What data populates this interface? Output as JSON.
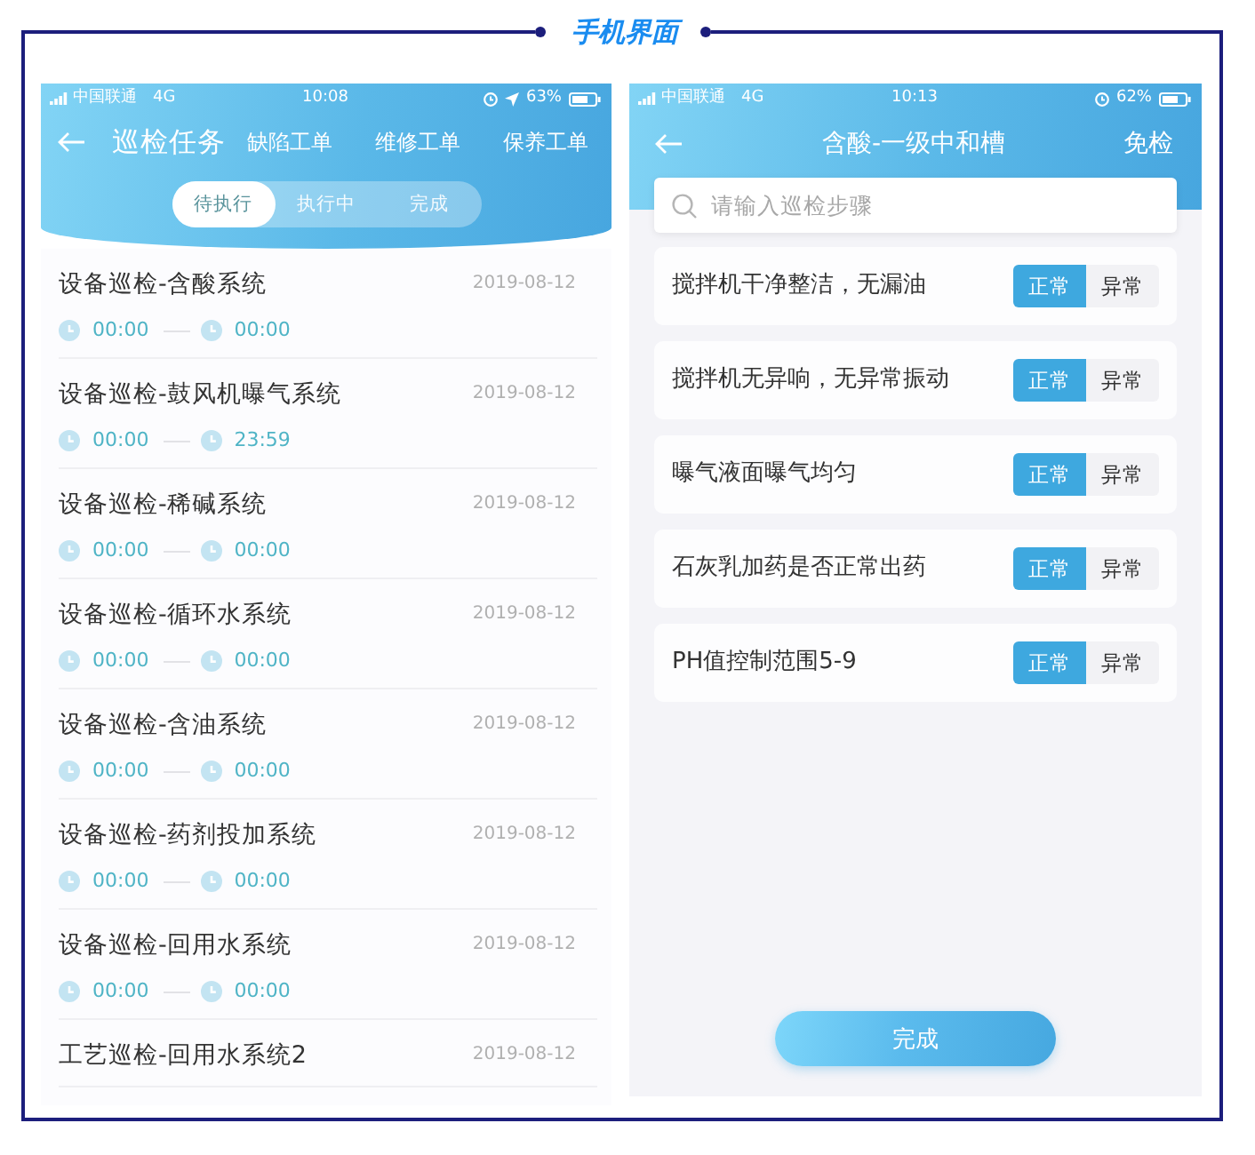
{
  "caption": "手机界面",
  "task_list_screen": {
    "status_bar": {
      "carrier": "中国联通",
      "network": "4G",
      "time": "10:08",
      "location": true,
      "battery": "63%"
    },
    "header": {
      "title": "巡检任务",
      "links": [
        "缺陷工单",
        "维修工单",
        "保养工单"
      ]
    },
    "tabs": [
      {
        "label": "待执行",
        "selected": true
      },
      {
        "label": "执行中",
        "selected": false
      },
      {
        "label": "完成",
        "selected": false
      }
    ],
    "tasks": [
      {
        "title": "设备巡检-含酸系统",
        "date": "2019-08-12",
        "start": "00:00",
        "end": "00:00"
      },
      {
        "title": "设备巡检-鼓风机曝气系统",
        "date": "2019-08-12",
        "start": "00:00",
        "end": "23:59"
      },
      {
        "title": "设备巡检-稀碱系统",
        "date": "2019-08-12",
        "start": "00:00",
        "end": "00:00"
      },
      {
        "title": "设备巡检-循环水系统",
        "date": "2019-08-12",
        "start": "00:00",
        "end": "00:00"
      },
      {
        "title": "设备巡检-含油系统",
        "date": "2019-08-12",
        "start": "00:00",
        "end": "00:00"
      },
      {
        "title": "设备巡检-药剂投加系统",
        "date": "2019-08-12",
        "start": "00:00",
        "end": "00:00"
      },
      {
        "title": "设备巡检-回用水系统",
        "date": "2019-08-12",
        "start": "00:00",
        "end": "00:00"
      },
      {
        "title": "工艺巡检-回用水系统2",
        "date": "2019-08-12"
      }
    ]
  },
  "checklist_screen": {
    "status_bar": {
      "carrier": "中国联通",
      "network": "4G",
      "time": "10:13",
      "location": false,
      "battery": "62%"
    },
    "header": {
      "title": "含酸-一级中和槽",
      "action": "免检"
    },
    "search": {
      "placeholder": "请输入巡检步骤"
    },
    "steps": [
      {
        "text": "搅拌机干净整洁，无漏油",
        "options": [
          {
            "label": "正常",
            "selected": true
          },
          {
            "label": "异常",
            "selected": false
          }
        ]
      },
      {
        "text": "搅拌机无异响，无异常振动",
        "options": [
          {
            "label": "正常",
            "selected": true
          },
          {
            "label": "异常",
            "selected": false
          }
        ]
      },
      {
        "text": "曝气液面曝气均匀",
        "options": [
          {
            "label": "正常",
            "selected": true
          },
          {
            "label": "异常",
            "selected": false
          }
        ]
      },
      {
        "text": "石灰乳加药是否正常出药",
        "options": [
          {
            "label": "正常",
            "selected": true
          },
          {
            "label": "异常",
            "selected": false
          }
        ]
      },
      {
        "text": "PH值控制范围5-9",
        "options": [
          {
            "label": "正常",
            "selected": true
          },
          {
            "label": "异常",
            "selected": false
          }
        ]
      }
    ],
    "submit": "完成"
  }
}
